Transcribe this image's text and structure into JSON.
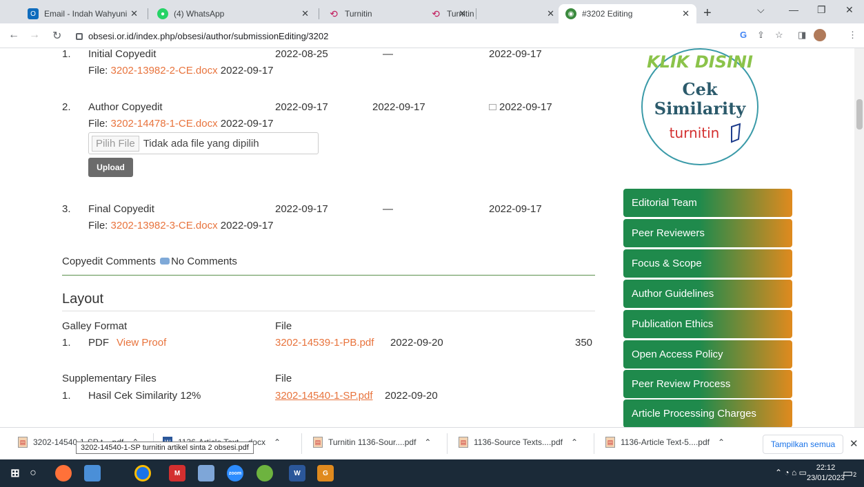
{
  "browser": {
    "tabs": [
      {
        "title": "Email - Indah Wahyuni - Out",
        "icon": "outlook-icon",
        "color": "#0f6cbd"
      },
      {
        "title": "(4) WhatsApp",
        "icon": "whatsapp-icon",
        "color": "#25d366"
      },
      {
        "title": "Turnitin",
        "icon": "turnitin-icon",
        "color": "#c2185b"
      },
      {
        "title": "Turnitin",
        "icon": "turnitin-icon",
        "color": "#c2185b"
      },
      {
        "title": "#3202 Editing",
        "icon": "obsesi-icon",
        "color": "#3b8a3e"
      }
    ],
    "url": "obsesi.or.id/index.php/obsesi/author/submissionEditing/3202"
  },
  "copyedit": {
    "rows": [
      {
        "num": "1.",
        "label": "Initial Copyedit",
        "requested": "2022-08-25",
        "underway": "—",
        "complete": "2022-09-17",
        "file_prefix": "File: ",
        "file": "3202-13982-2-CE.docx",
        "file_date": "2022-09-17"
      },
      {
        "num": "2.",
        "label": "Author Copyedit",
        "requested": "2022-09-17",
        "underway": "2022-09-17",
        "complete": "2022-09-17",
        "file_prefix": "File: ",
        "file": "3202-14478-1-CE.docx",
        "file_date": "2022-09-17"
      },
      {
        "num": "3.",
        "label": "Final Copyedit",
        "requested": "2022-09-17",
        "underway": "—",
        "complete": "2022-09-17",
        "file_prefix": "File: ",
        "file": "3202-13982-3-CE.docx",
        "file_date": "2022-09-17"
      }
    ],
    "file_button": "Pilih File",
    "file_status": "Tidak ada file yang dipilih",
    "upload_label": "Upload",
    "comments_label": "Copyedit Comments",
    "comments_value": "No Comments"
  },
  "layout": {
    "heading": "Layout",
    "galley_label": "Galley Format",
    "file_label": "File",
    "galley": {
      "num": "1.",
      "format": "PDF",
      "view_proof": "View Proof",
      "file": "3202-14539-1-PB.pdf",
      "date": "2022-09-20",
      "count": "350"
    },
    "supp_label": "Supplementary Files",
    "supp_file_label": "File",
    "supp": {
      "num": "1.",
      "name": "Hasil Cek Similarity 12%",
      "file": "3202-14540-1-SP.pdf",
      "date": "2022-09-20"
    }
  },
  "sidebar": {
    "logo_top": "KLIK DISINI",
    "logo_mid1": "Cek",
    "logo_mid2": "Similarity",
    "logo_brand": "turnitin",
    "menu": [
      "Editorial Team",
      "Peer Reviewers",
      "Focus & Scope",
      "Author Guidelines",
      "Publication Ethics",
      "Open Access Policy",
      "Peer Review Process",
      "Article Processing Charges"
    ]
  },
  "downloads": {
    "items": [
      "3202-14540-1-SP t....pdf",
      "1136-Article Text....docx",
      "Turnitin 1136-Sour....pdf",
      "1136-Source Texts....pdf",
      "1136-Article Text-5....pdf"
    ],
    "show_all": "Tampilkan semua",
    "tooltip": "3202-14540-1-SP turnitin artikel sinta 2 obsesi.pdf"
  },
  "taskbar": {
    "time": "22:12",
    "date": "23/01/2023",
    "notif_count": "2"
  }
}
